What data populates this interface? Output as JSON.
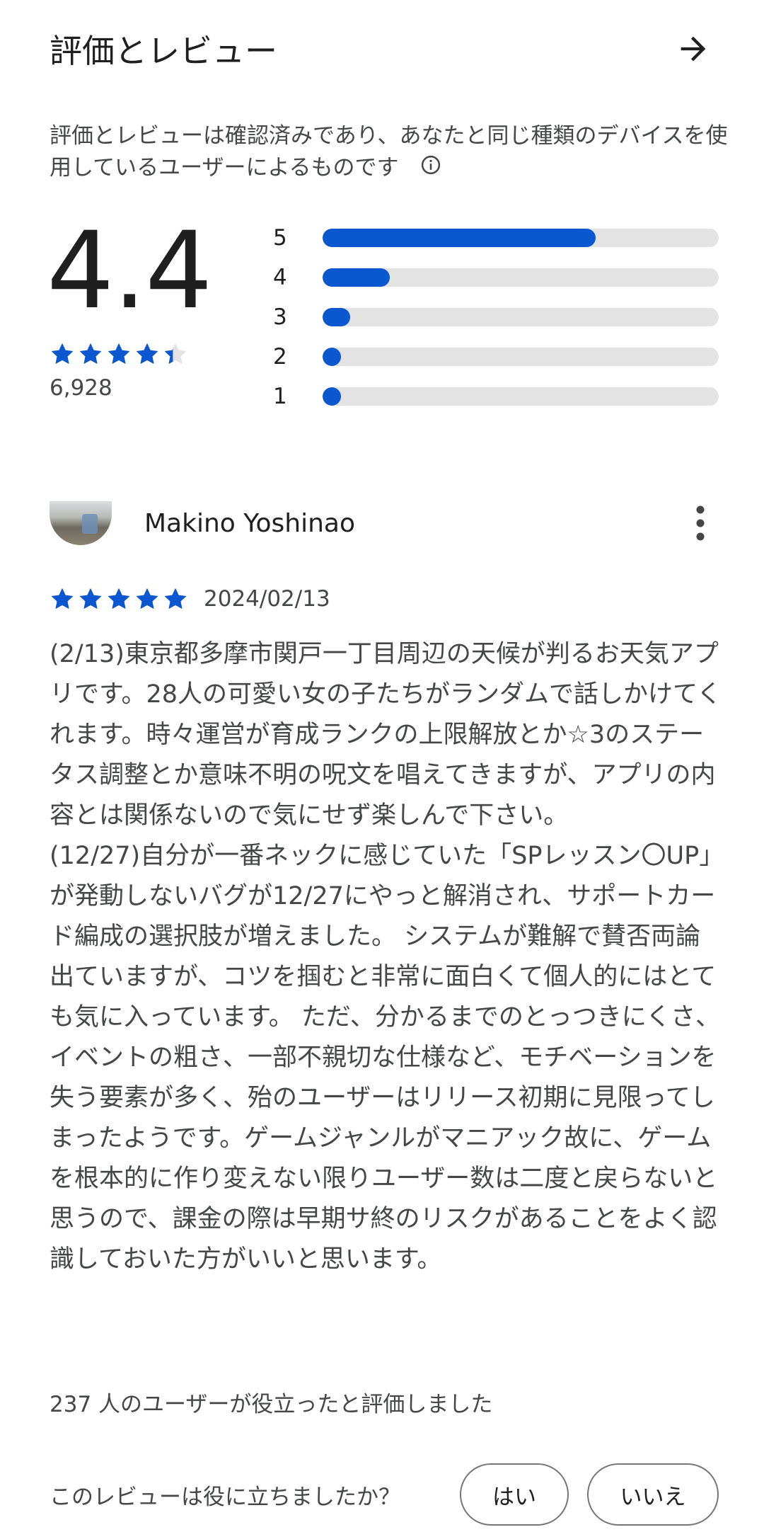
{
  "header": {
    "title": "評価とレビュー",
    "arrow_icon": "arrow-right-icon"
  },
  "notice": {
    "text": "評価とレビューは確認済みであり、あなたと同じ種類のデバイスを使用しているユーザーによるものです",
    "info_icon": "info-icon"
  },
  "summary": {
    "average": "4.4",
    "average_value": 4.4,
    "count": "6,928",
    "star_color": "#0b57d0",
    "distribution": [
      {
        "label": "5",
        "fraction": 0.69
      },
      {
        "label": "4",
        "fraction": 0.17
      },
      {
        "label": "3",
        "fraction": 0.07
      },
      {
        "label": "2",
        "fraction": 0.04
      },
      {
        "label": "1",
        "fraction": 0.04
      }
    ]
  },
  "review": {
    "author": "Makino Yoshinao",
    "rating": 5,
    "date": "2024/02/13",
    "text": "(2/13)東京都多摩市関戸一丁目周辺の天候が判るお天気アプリです。28人の可愛い女の子たちがランダムで話しかけてくれます。時々運営が育成ランクの上限解放とか☆3のステータス調整とか意味不明の呪文を唱えてきますが、アプリの内容とは関係ないので気にせず楽しんで下さい。\n(12/27)自分が一番ネックに感じていた「SPレッスン〇UP」が発動しないバグが12/27にやっと解消され、サポートカード編成の選択肢が増えました。 システムが難解で賛否両論出ていますが、コツを掴むと非常に面白くて個人的にはとても気に入っています。 ただ、分かるまでのとっつきにくさ、イベントの粗さ、一部不親切な仕様など、モチベーションを失う要素が多く、殆のユーザーはリリース初期に見限ってしまったようです。ゲームジャンルがマニアック故に、ゲームを根本的に作り変えない限りユーザー数は二度と戻らないと思うので、課金の際は早期サ終のリスクがあることをよく認識しておいた方がいいと思います。",
    "helpful_count_text": "237 人のユーザーが役立ったと評価しました",
    "more_icon": "more-vert-icon"
  },
  "feedback": {
    "question": "このレビューは役に立ちましたか？",
    "yes_label": "はい",
    "no_label": "いいえ"
  }
}
